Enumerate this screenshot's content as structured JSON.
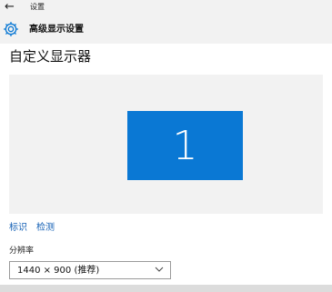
{
  "window": {
    "title": "设置",
    "back_icon": "back-arrow-icon"
  },
  "header": {
    "title": "高级显示设置",
    "icon": "gear-icon"
  },
  "page": {
    "title": "自定义显示器"
  },
  "monitor": {
    "number": "1",
    "color": "#0a78d4"
  },
  "links": {
    "identify": "标识",
    "detect": "检测"
  },
  "resolution": {
    "label": "分辨率",
    "value": "1440 × 900 (推荐)",
    "icon": "chevron-down-icon"
  }
}
